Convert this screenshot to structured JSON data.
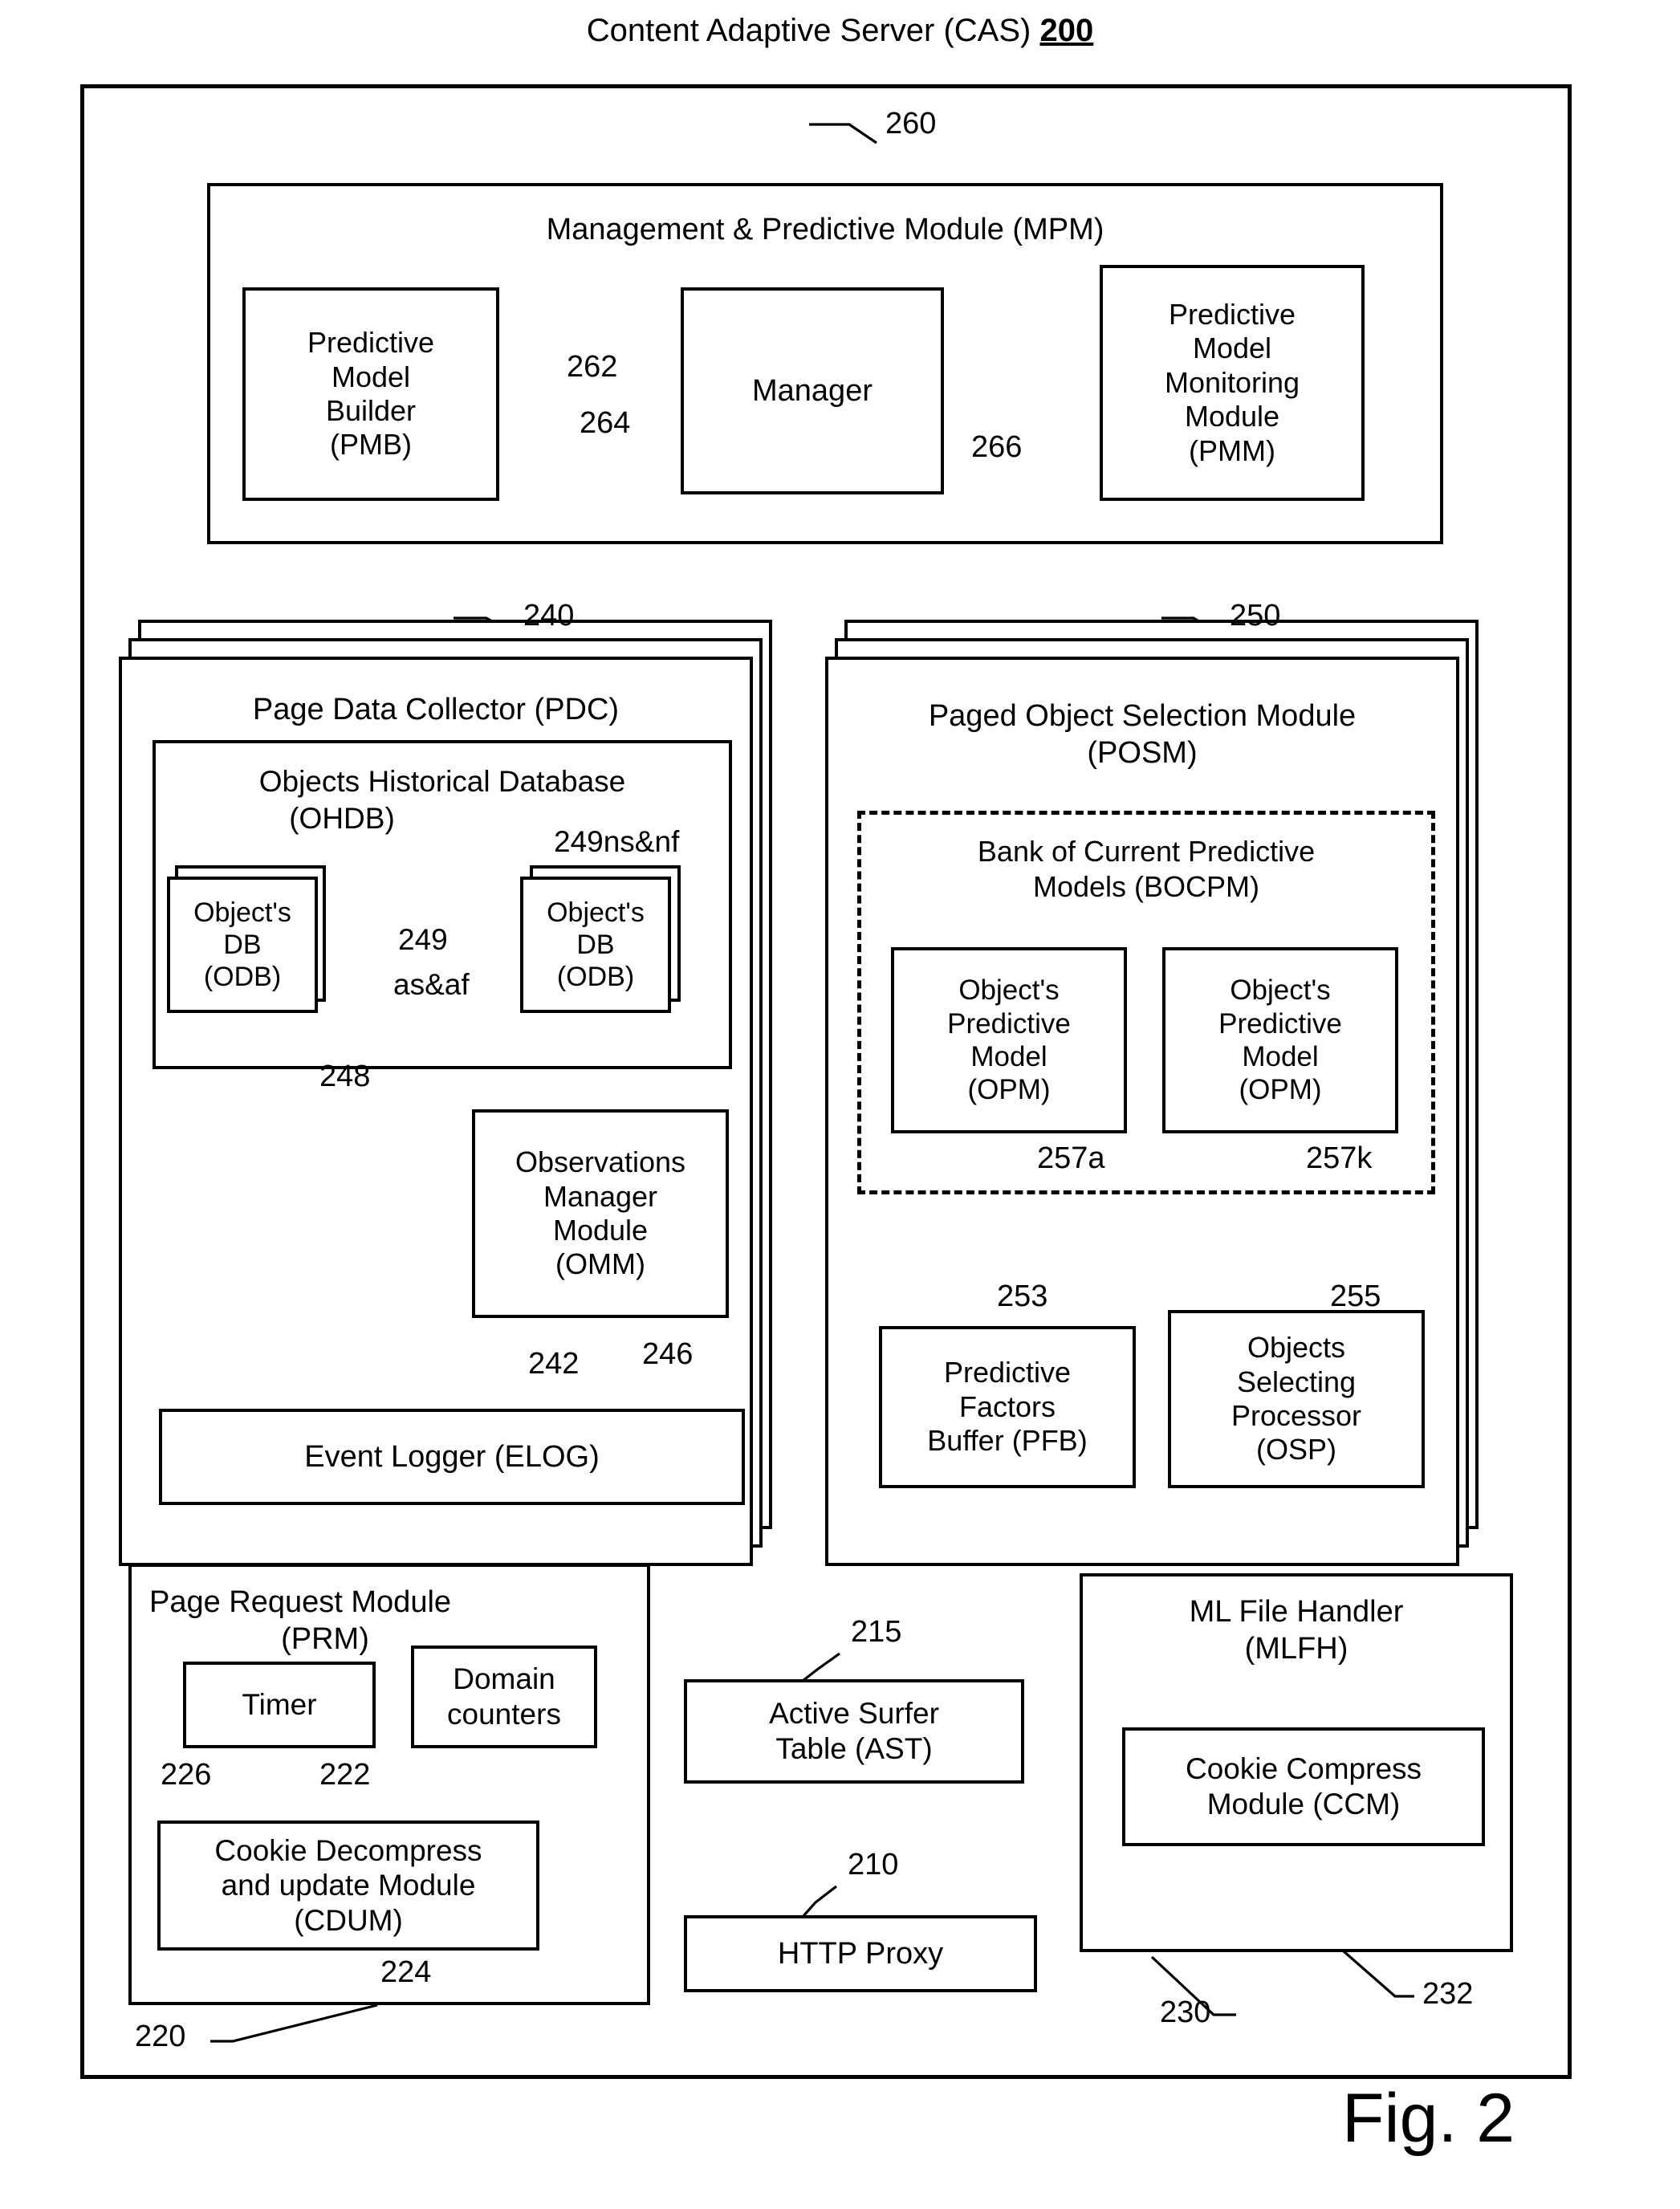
{
  "figure": {
    "caption": "Fig. 2",
    "title_text": "Content Adaptive Server (CAS)",
    "title_number": "200"
  },
  "outer_frame": {
    "ref": "200"
  },
  "mpm": {
    "title": "Management & Predictive Module (MPM)",
    "ref": "260",
    "children": [
      {
        "label": "Predictive\nModel\nBuilder\n(PMB)",
        "ref": "262"
      },
      {
        "label": "Manager",
        "ref": "264"
      },
      {
        "label": "Predictive\nModel\nMonitoring\nModule\n(PMM)",
        "ref": "266"
      }
    ],
    "pmb_label_l1": "Predictive",
    "pmb_label_l2": "Model",
    "pmb_label_l3": "Builder",
    "pmb_label_l4": "(PMB)",
    "pmb_ref": "262",
    "manager_label": "Manager",
    "manager_ref": "264",
    "pmm_label_l1": "Predictive",
    "pmm_label_l2": "Model",
    "pmm_label_l3": "Monitoring",
    "pmm_label_l4": "Module",
    "pmm_label_l5": "(PMM)",
    "pmm_ref": "266"
  },
  "pdc": {
    "title": "Page Data Collector (PDC)",
    "ref": "240",
    "ohdb": {
      "title_l1": "Objects Historical Database",
      "title_l2": "(OHDB)",
      "ref": "248",
      "odb_left": {
        "l1": "Object's",
        "l2": "DB",
        "l3": "(ODB)"
      },
      "odb_right": {
        "l1": "Object's",
        "l2": "DB",
        "l3": "(ODB)"
      },
      "ref_left_l1": "249",
      "ref_left_l2": "as&af",
      "ref_right": "249ns&nf"
    },
    "omm": {
      "l1": "Observations",
      "l2": "Manager",
      "l3": "Module",
      "l4": "(OMM)",
      "ref": "246"
    },
    "elog": {
      "label": "Event Logger (ELOG)",
      "ref": "242"
    }
  },
  "posm": {
    "title_l1": "Paged Object Selection Module",
    "title_l2": "(POSM)",
    "ref": "250",
    "bocpm": {
      "title_l1": "Bank of Current Predictive",
      "title_l2": "Models (BOCPM)",
      "opm_left": {
        "l1": "Object's",
        "l2": "Predictive",
        "l3": "Model",
        "l4": "(OPM)",
        "ref": "257a"
      },
      "opm_right": {
        "l1": "Object's",
        "l2": "Predictive",
        "l3": "Model",
        "l4": "(OPM)",
        "ref": "257k"
      }
    },
    "pfb": {
      "l1": "Predictive",
      "l2": "Factors",
      "l3": "Buffer (PFB)",
      "ref": "253"
    },
    "osp": {
      "l1": "Objects",
      "l2": "Selecting",
      "l3": "Processor",
      "l4": "(OSP)",
      "ref": "255"
    }
  },
  "prm": {
    "title_l1": "Page Request Module",
    "title_l2": "(PRM)",
    "ref": "220",
    "timer": {
      "label": "Timer",
      "ref": "226"
    },
    "domain_counters": {
      "l1": "Domain",
      "l2": "counters",
      "ref": "222"
    },
    "cdum": {
      "l1": "Cookie Decompress",
      "l2": "and update Module",
      "l3": "(CDUM)",
      "ref": "224"
    }
  },
  "ast": {
    "l1": "Active Surfer",
    "l2": "Table (AST)",
    "ref": "215"
  },
  "http_proxy": {
    "label": "HTTP Proxy",
    "ref": "210"
  },
  "mlfh": {
    "title_l1": "ML File Handler",
    "title_l2": "(MLFH)",
    "ref": "230",
    "ccm": {
      "l1": "Cookie Compress",
      "l2": "Module (CCM)",
      "ref": "232"
    }
  }
}
